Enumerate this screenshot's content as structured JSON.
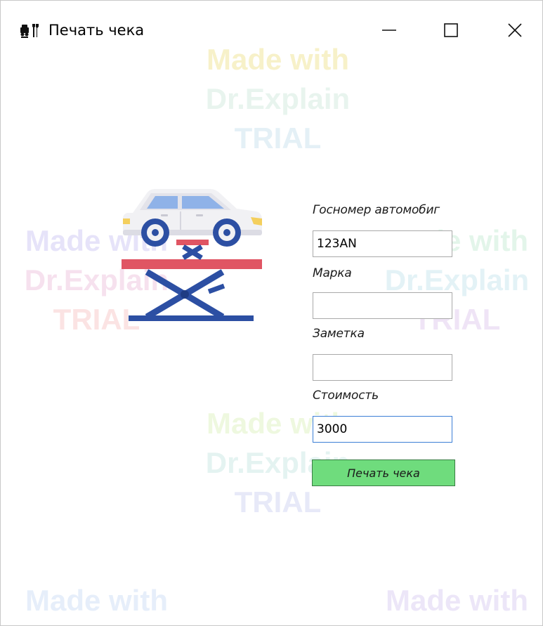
{
  "window": {
    "title": "Печать чека",
    "app_icon": "car-service-icon",
    "controls": {
      "minimize_icon": "minimize-icon",
      "maximize_icon": "maximize-icon",
      "close_icon": "close-icon"
    }
  },
  "watermark": {
    "line1": "Made with",
    "line2": "Dr.Explain",
    "line3": "TRIAL"
  },
  "illustration": {
    "icon": "car-lift-icon"
  },
  "form": {
    "plate_label": "Госномер автомобиг",
    "plate_value": "123AN",
    "brand_label": "Марка",
    "brand_value": "",
    "note_label": "Заметка",
    "note_value": "",
    "cost_label": "Стоимость",
    "cost_value": "3000",
    "print_button": "Печать чека"
  },
  "colors": {
    "button_green": "#6fdc7d",
    "focus_blue": "#3c7fd6",
    "car_blue": "#2c4fa3",
    "lift_red": "#e05563"
  }
}
